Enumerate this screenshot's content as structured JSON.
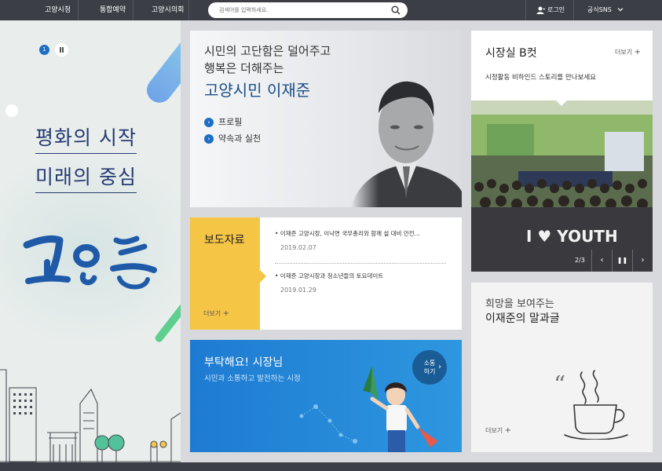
{
  "nav": {
    "items": [
      "고양시청",
      "통합예약",
      "고양시의회"
    ],
    "search_placeholder": "검색어를 입력하세요.",
    "login_label": "로그인",
    "sns_label": "공식SNS"
  },
  "banner": {
    "slide_number": "1",
    "slogan_line1": "평화의 시작",
    "slogan_line2": "미래의 중심"
  },
  "profile": {
    "line1": "시민의 고단함은 덜어주고",
    "line2": "행복은 더해주는",
    "name": "고양시민 이재준",
    "links": [
      "프로필",
      "약속과 실천"
    ]
  },
  "press": {
    "title": "보도자료",
    "more_label": "더보기",
    "items": [
      {
        "title": "• 이재준 고양시장, 이낙연 국무총리와 함께 설 대비 안전...",
        "date": "2019.02.07"
      },
      {
        "title": "• 이재준 고양시장과 청소년들의 토요데이트",
        "date": "2019.01.29"
      }
    ]
  },
  "mayor": {
    "title": "부탁해요! 시장님",
    "subtitle": "시민과 소통하고 발전하는 시정",
    "cta_line1": "소통",
    "cta_line2": "하기"
  },
  "photo": {
    "title": "시장실 B컷",
    "more_label": "더보기",
    "description": "시정활동 비하인드 스토리를 만나보세요",
    "counter": "2/3",
    "banner_text": "I ♥ YOUTH"
  },
  "quote": {
    "line1": "희망을 보여주는",
    "line2": "이재준의 말과글",
    "more_label": "더보기"
  },
  "colors": {
    "nav_bg": "#3b3e45",
    "accent_blue": "#1d6fc4",
    "press_yellow": "#f5c546",
    "mayor_blue": "#2e8ad8",
    "name_blue": "#1a4f86"
  }
}
